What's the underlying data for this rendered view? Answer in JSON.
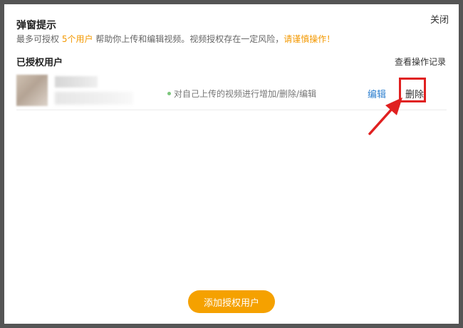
{
  "dialog": {
    "close_label": "关闭",
    "title": "弹窗提示",
    "notice": {
      "part1": "最多可授权 ",
      "limit": "5个用户",
      "part2": " 帮助你上传和编辑视频。视频授权存在一定风险，",
      "warning": "请谨慎操作！"
    }
  },
  "authorized_section": {
    "title": "已授权用户",
    "log_link": "查看操作记录",
    "users": [
      {
        "permission": "对自己上传的视频进行增加/删除/编辑",
        "edit_label": "编辑",
        "delete_label": "删除"
      }
    ]
  },
  "footer": {
    "add_button_label": "添加授权用户"
  },
  "colors": {
    "accent_orange": "#f5a100",
    "link_blue": "#2d7fcf",
    "highlight_red": "#e02020",
    "status_green": "#7cc67c"
  }
}
